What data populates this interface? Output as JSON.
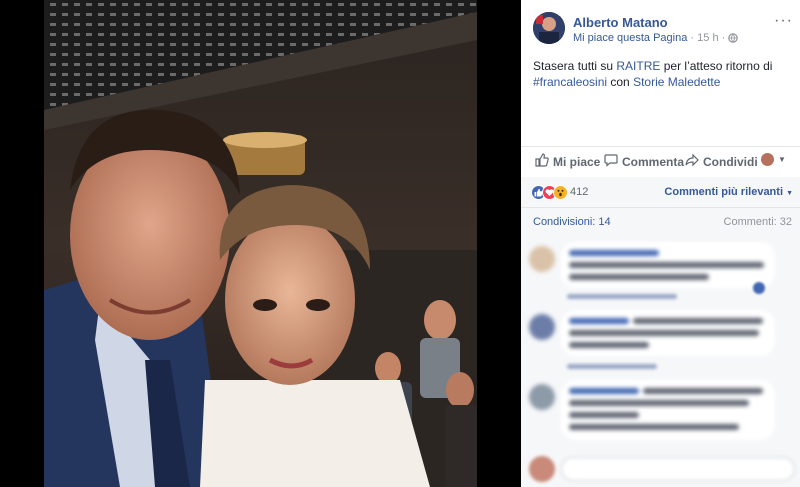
{
  "post": {
    "author": "Alberto Matano",
    "follow_label": "Mi piace questa Pagina",
    "separator": "·",
    "time": "15 h",
    "separator2": "·",
    "more": "···",
    "text_part1": "Stasera tutti su ",
    "text_link1": "RAITRE",
    "text_part2": " per l’atteso ritorno di",
    "text_link2": "#francaleosini",
    "text_part3": " con ",
    "text_link3": "Storie Maledette"
  },
  "actions": {
    "like": "Mi piace",
    "comment": "Commenta",
    "share": "Condividi"
  },
  "reactions": {
    "count": "412",
    "sort": "Commenti più rilevanti",
    "colors": {
      "like": "#4267b2",
      "love": "#f33e58",
      "wow": "#f7b125"
    }
  },
  "stats": {
    "shares": "Condivisioni: 14",
    "comments": "Commenti: 32"
  },
  "colors": {
    "link": "#365899",
    "meta": "#90949c",
    "action": "#606770",
    "panel_bg": "#f6f7f9"
  },
  "icons": {
    "like": "thumb-up-icon",
    "comment": "speech-bubble-icon",
    "share": "share-arrow-icon",
    "globe": "globe-icon",
    "dropdown": "chevron-down-icon"
  }
}
